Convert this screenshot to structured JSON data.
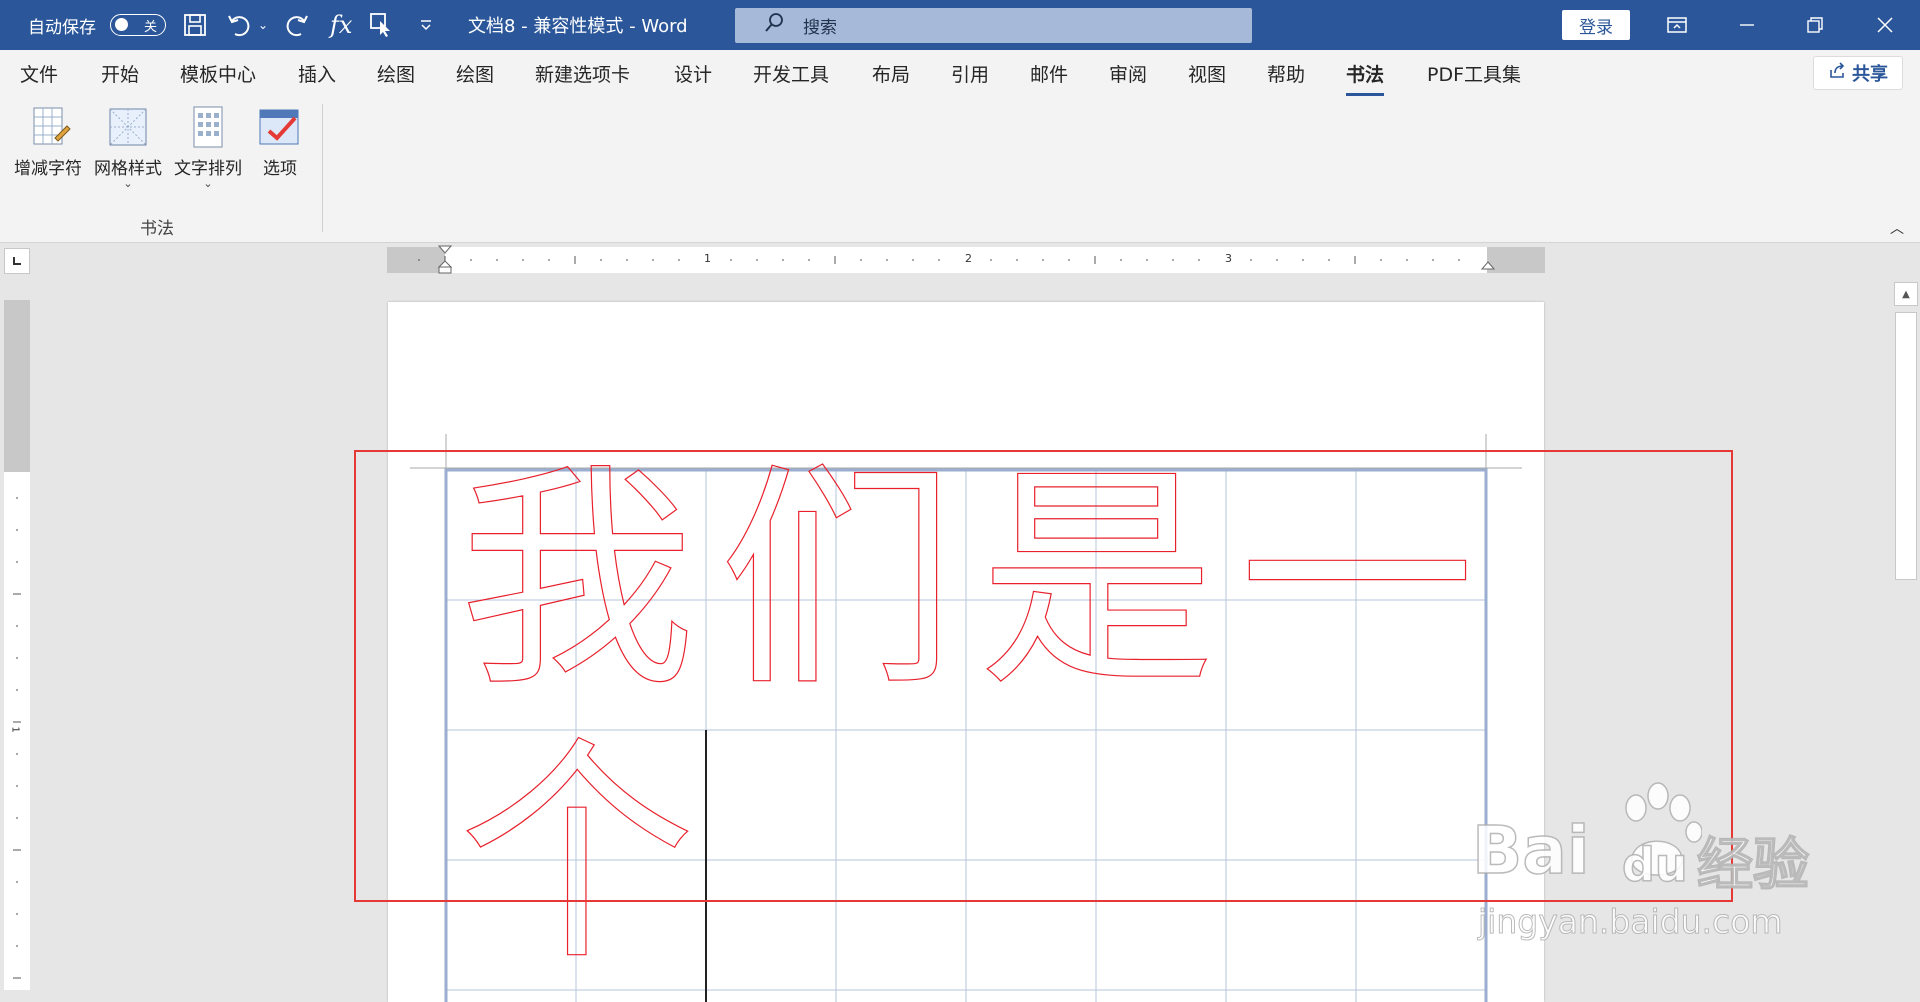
{
  "titlebar": {
    "autosave_label": "自动保存",
    "autosave_state": "关",
    "doc_title": "文档8  -  兼容性模式  -  Word",
    "search_placeholder": "搜索",
    "login_label": "登录"
  },
  "menu": {
    "tabs": [
      "文件",
      "开始",
      "模板中心",
      "插入",
      "绘图",
      "绘图",
      "新建选项卡",
      "设计",
      "开发工具",
      "布局",
      "引用",
      "邮件",
      "审阅",
      "视图",
      "帮助",
      "书法",
      "PDF工具集"
    ],
    "active_tab": "书法",
    "share_label": "共享"
  },
  "ribbon": {
    "buttons": [
      {
        "label": "增减字符",
        "icon": "add-remove-chars-icon"
      },
      {
        "label": "网格样式",
        "icon": "grid-style-icon"
      },
      {
        "label": "文字排列",
        "icon": "text-arrange-icon"
      },
      {
        "label": "选项",
        "icon": "options-icon"
      }
    ],
    "group_label": "书法"
  },
  "rulers": {
    "h_numbers": [
      "1",
      "2",
      "3"
    ],
    "v_numbers": [
      "1"
    ]
  },
  "document": {
    "characters": [
      "我",
      "们",
      "是",
      "一",
      "个"
    ]
  },
  "watermark": {
    "brand": "Bai",
    "brand2": "du",
    "label": "经验",
    "url": "jingyan.baidu.com"
  },
  "colors": {
    "title_bg": "#2b579a",
    "char_outline": "#e8212c",
    "grid": "#a9bdd8",
    "highlight": "#e53935"
  }
}
